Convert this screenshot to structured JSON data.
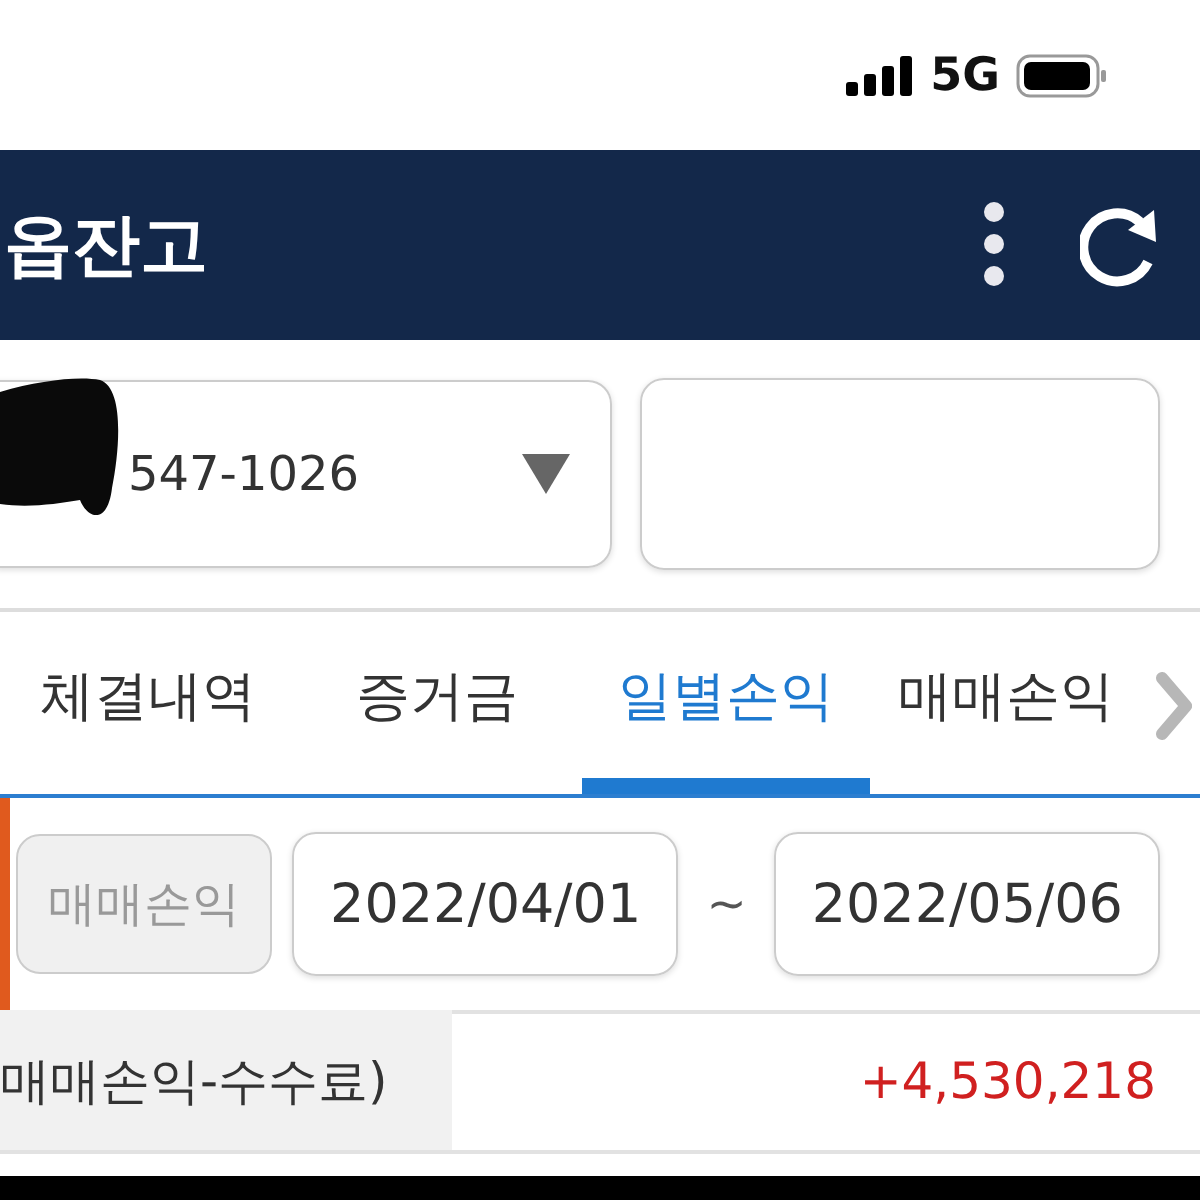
{
  "status_bar": {
    "network": "5G"
  },
  "header": {
    "title": "옵잔고"
  },
  "account": {
    "number": "547-1026"
  },
  "tabs": [
    {
      "label": "체결내역",
      "selected": false
    },
    {
      "label": "증거금",
      "selected": false
    },
    {
      "label": "일별손익",
      "selected": true
    },
    {
      "label": "매매손익",
      "selected": false
    }
  ],
  "filter": {
    "chip": "매매손익",
    "start_date": "2022/04/01",
    "separator": "~",
    "end_date": "2022/05/06"
  },
  "summary": {
    "label": "매매손익-수수료)",
    "value": "+4,530,218"
  }
}
